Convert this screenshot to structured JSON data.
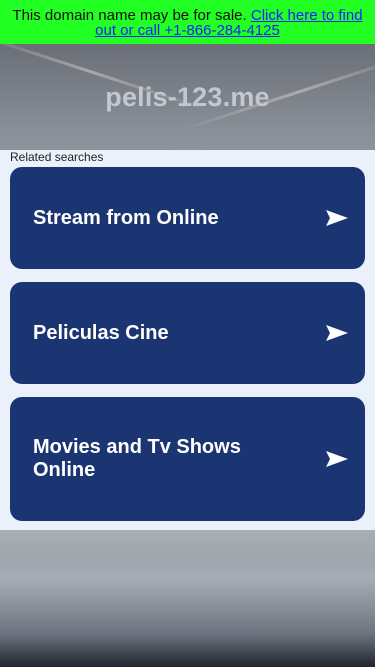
{
  "banner": {
    "text": "This domain name may be for sale.",
    "link_text": "Click here to find out or call +1-866-284-4125"
  },
  "header": {
    "domain": "pelis-123.me"
  },
  "related": {
    "heading": "Related searches",
    "items": [
      {
        "label": "Stream from Online"
      },
      {
        "label": "Peliculas Cine"
      },
      {
        "label": "Movies and Tv Shows Online"
      }
    ]
  },
  "colors": {
    "banner_bg": "#22ff22",
    "link": "#1a22ff",
    "card_bg": "#1b3472",
    "panel_bg": "#eaf1fb"
  }
}
